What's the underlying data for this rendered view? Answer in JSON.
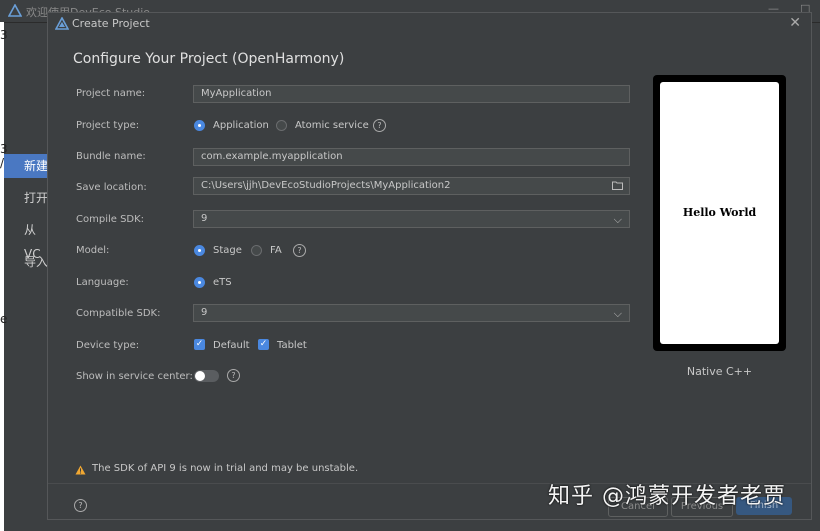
{
  "background_window": {
    "title": "欢迎使用DevEco Studio",
    "sidebar_items": [
      "新建",
      "打开",
      "从VC",
      "导入"
    ],
    "minimize_glyph": "—",
    "restore_glyph": "□",
    "edge_glyphs": [
      "3",
      "3",
      "/",
      "e"
    ]
  },
  "dialog": {
    "title": "Create Project",
    "close_glyph": "✕",
    "heading": "Configure Your Project (OpenHarmony)",
    "fields": {
      "project_name": {
        "label": "Project name:",
        "value": "MyApplication"
      },
      "project_type": {
        "label": "Project type:",
        "options": [
          "Application",
          "Atomic service"
        ],
        "selected": "Application"
      },
      "bundle_name": {
        "label": "Bundle name:",
        "value": "com.example.myapplication"
      },
      "save_location": {
        "label": "Save location:",
        "value": "C:\\Users\\jjh\\DevEcoStudioProjects\\MyApplication2"
      },
      "compile_sdk": {
        "label": "Compile SDK:",
        "value": "9"
      },
      "model": {
        "label": "Model:",
        "options": [
          "Stage",
          "FA"
        ],
        "selected": "Stage"
      },
      "language": {
        "label": "Language:",
        "options": [
          "eTS"
        ],
        "selected": "eTS"
      },
      "compatible_sdk": {
        "label": "Compatible SDK:",
        "value": "9"
      },
      "device_type": {
        "label": "Device type:",
        "options": [
          "Default",
          "Tablet"
        ],
        "checked": [
          "Default",
          "Tablet"
        ]
      },
      "service_center": {
        "label": "Show in service center:",
        "enabled": false
      }
    },
    "help_glyph": "?",
    "chevron_glyph": "⌵",
    "check_glyph": "✓",
    "preview": {
      "screen_text": "Hello World",
      "template_name": "Native C++"
    },
    "warning": "The SDK of API 9 is now in trial and may be unstable.",
    "footer_buttons": [
      "Cancel",
      "Previous",
      "Finish"
    ]
  },
  "watermark": "知乎 @鸿蒙开发者老贾",
  "colors": {
    "dialog_bg": "#3c3f41",
    "accent": "#4a88e0",
    "warning": "#f0a732",
    "sidebar_active": "#4a78c2"
  },
  "icons": [
    "deveco-logo-icon",
    "close-icon",
    "help-icon",
    "folder-icon",
    "chevron-down-icon",
    "warning-icon",
    "checkbox-checked-icon"
  ]
}
